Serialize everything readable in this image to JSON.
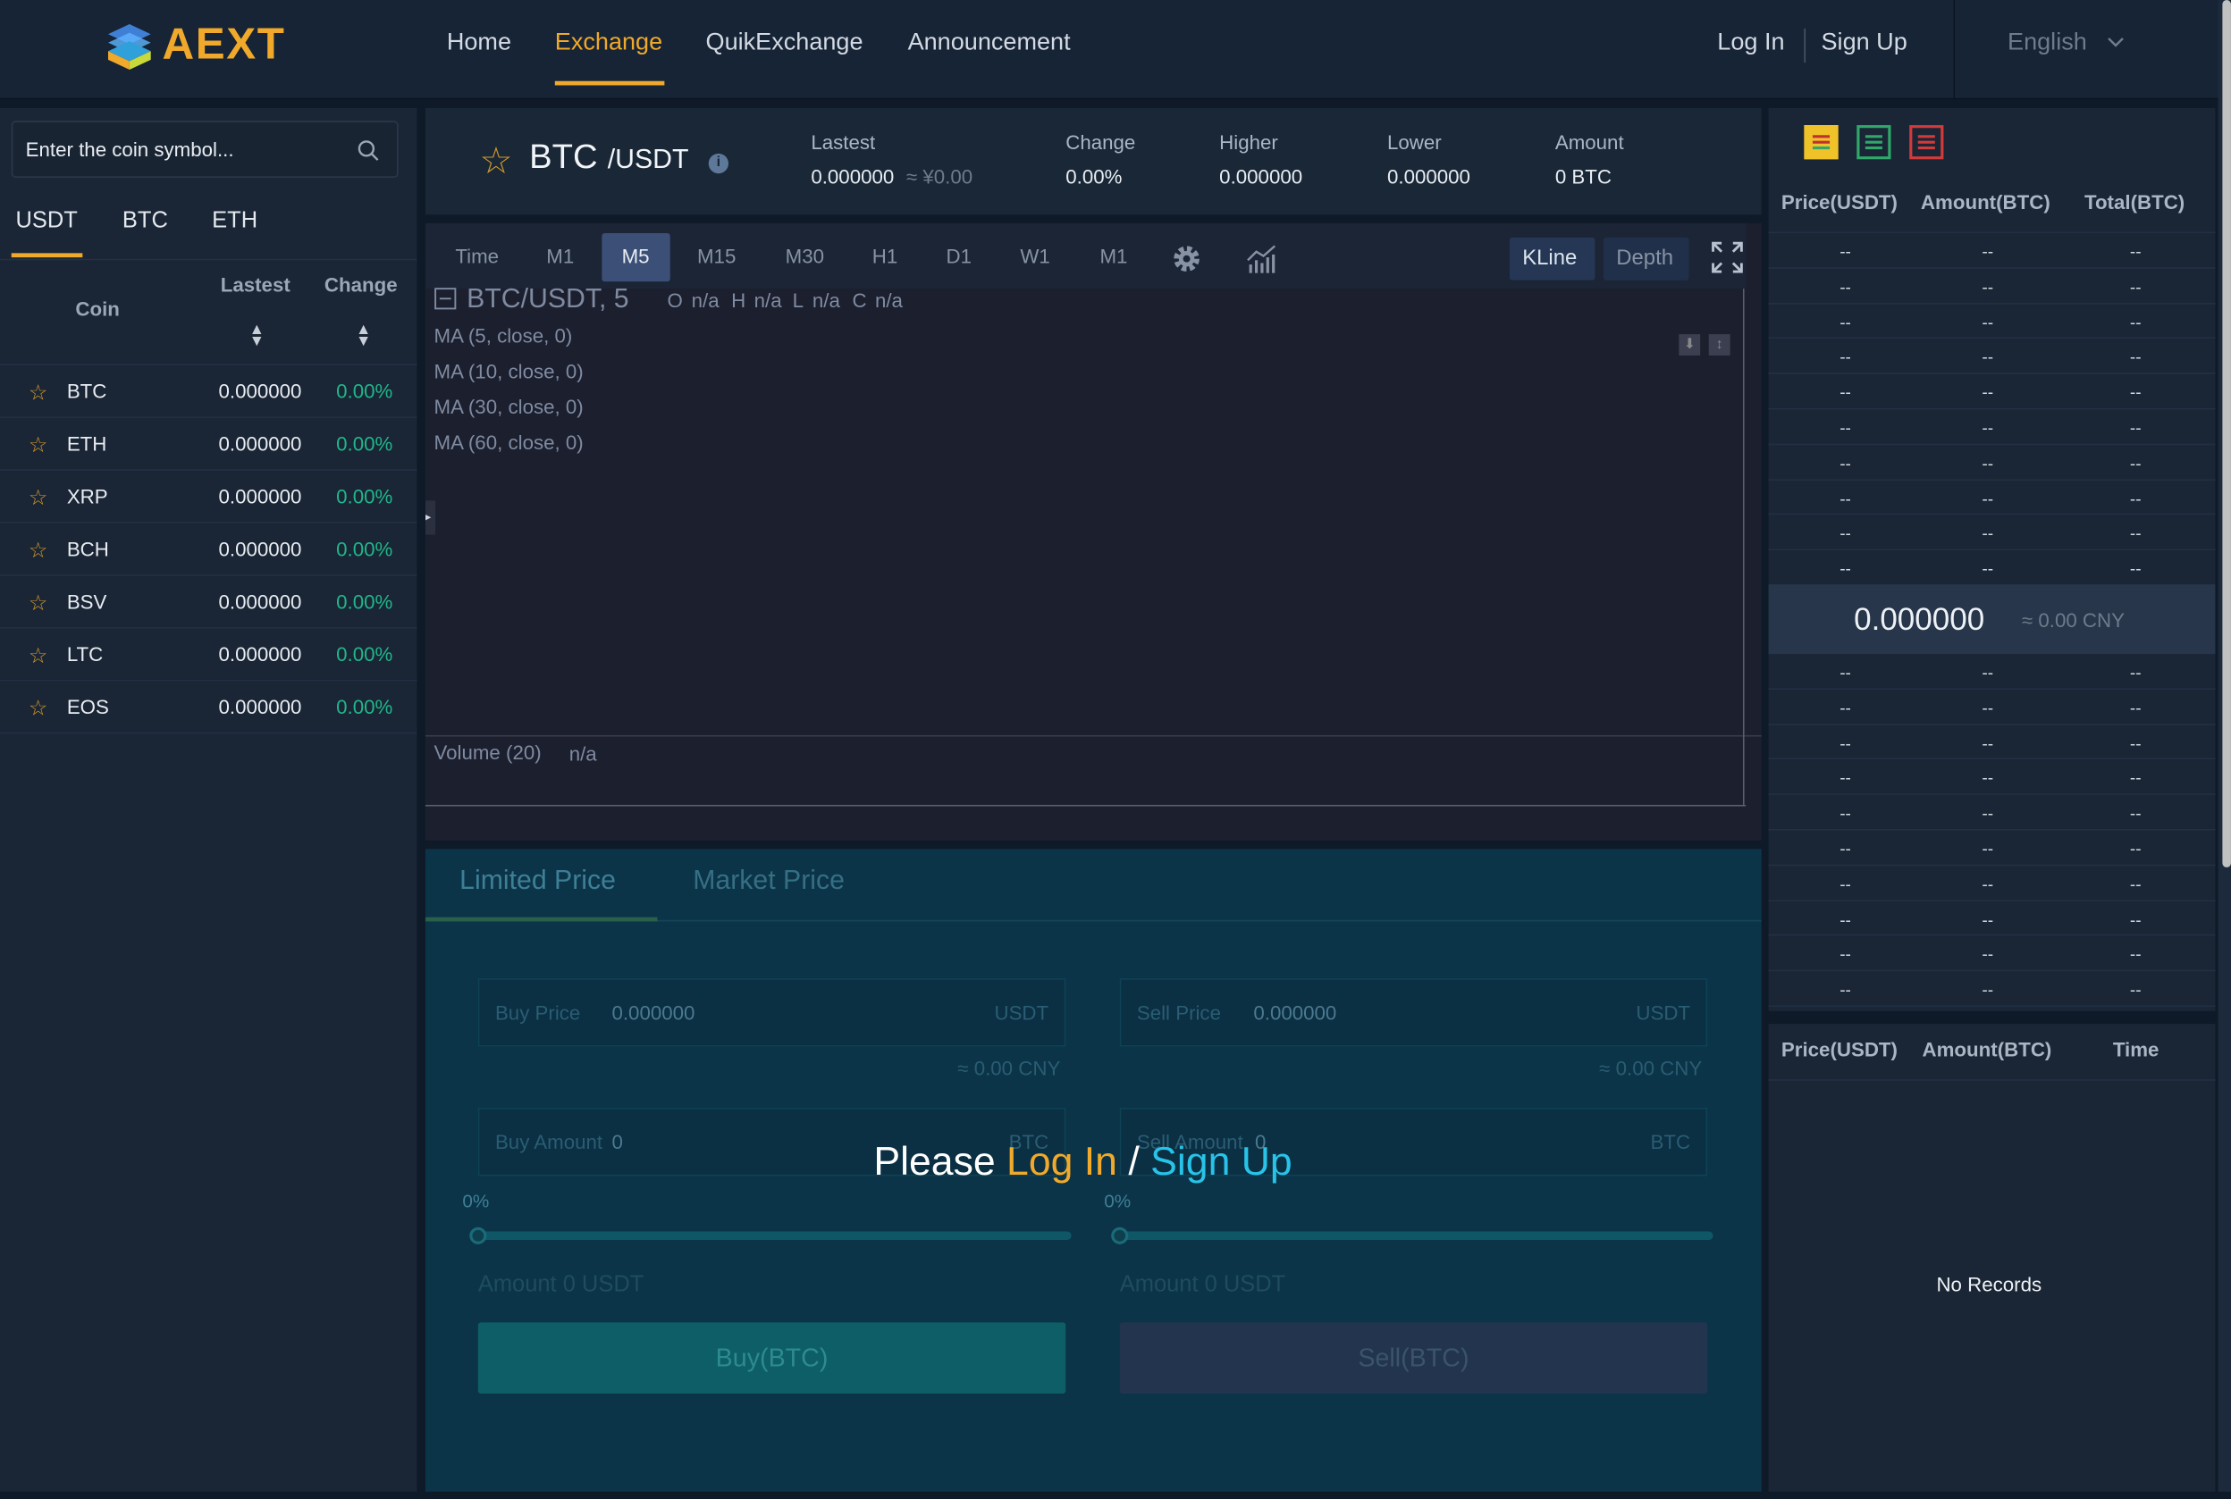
{
  "brand": {
    "name": "AEXT",
    "accent": "#f0a92a"
  },
  "nav": {
    "items": [
      "Home",
      "Exchange",
      "QuikExchange",
      "Announcement"
    ],
    "active": "Exchange",
    "login": "Log In",
    "signup": "Sign Up",
    "language": "English"
  },
  "market": {
    "search_placeholder": "Enter the coin symbol...",
    "tabs": [
      "USDT",
      "BTC",
      "ETH"
    ],
    "active_tab": "USDT",
    "columns": {
      "coin": "Coin",
      "latest": "Lastest",
      "change": "Change"
    },
    "rows": [
      {
        "symbol": "BTC",
        "price": "0.000000",
        "change": "0.00%"
      },
      {
        "symbol": "ETH",
        "price": "0.000000",
        "change": "0.00%"
      },
      {
        "symbol": "XRP",
        "price": "0.000000",
        "change": "0.00%"
      },
      {
        "symbol": "BCH",
        "price": "0.000000",
        "change": "0.00%"
      },
      {
        "symbol": "BSV",
        "price": "0.000000",
        "change": "0.00%"
      },
      {
        "symbol": "LTC",
        "price": "0.000000",
        "change": "0.00%"
      },
      {
        "symbol": "EOS",
        "price": "0.000000",
        "change": "0.00%"
      }
    ]
  },
  "ticker": {
    "base": "BTC",
    "quote": "/USDT",
    "latest_label": "Lastest",
    "latest_value": "0.000000",
    "latest_cny": "≈ ¥0.00",
    "change_label": "Change",
    "change_value": "0.00%",
    "higher_label": "Higher",
    "higher_value": "0.000000",
    "lower_label": "Lower",
    "lower_value": "0.000000",
    "amount_label": "Amount",
    "amount_value": "0 BTC"
  },
  "chart": {
    "timeframes": [
      "Time",
      "M1",
      "M5",
      "M15",
      "M30",
      "H1",
      "D1",
      "W1",
      "M1"
    ],
    "active_timeframe": "M5",
    "kline_label": "KLine",
    "depth_label": "Depth",
    "pair_title": "BTC/USDT, 5",
    "ohlc": [
      "O",
      "n/a",
      "H",
      "n/a",
      "L",
      "n/a",
      "C",
      "n/a"
    ],
    "indicators": [
      "MA (5, close, 0)",
      "MA (10, close, 0)",
      "MA (30, close, 0)",
      "MA (60, close, 0)"
    ],
    "volume_label": "Volume (20)",
    "volume_value": "n/a"
  },
  "trade": {
    "tabs": [
      "Limited Price",
      "Market Price"
    ],
    "buy": {
      "price_label": "Buy Price",
      "price_value": "0.000000",
      "price_unit": "USDT",
      "cny": "≈ 0.00 CNY",
      "amount_label": "Buy Amount",
      "amount_value": "0",
      "amount_unit": "BTC",
      "percent": "0%",
      "total": "Amount 0 USDT",
      "button": "Buy(BTC)"
    },
    "sell": {
      "price_label": "Sell Price",
      "price_value": "0.000000",
      "price_unit": "USDT",
      "cny": "≈ 0.00 CNY",
      "amount_label": "Sell Amount",
      "amount_value": "0",
      "amount_unit": "BTC",
      "percent": "0%",
      "total": "Amount 0 USDT",
      "button": "Sell(BTC)"
    },
    "prompt": {
      "please": "Please",
      "login": "Log In",
      "sep": "/",
      "signup": "Sign Up"
    }
  },
  "orderbook": {
    "headers": [
      "Price(USDT)",
      "Amount(BTC)",
      "Total(BTC)"
    ],
    "placeholder": "--",
    "mid_price": "0.000000",
    "mid_cny": "≈ 0.00 CNY"
  },
  "trades": {
    "headers": [
      "Price(USDT)",
      "Amount(BTC)",
      "Time"
    ],
    "empty": "No Records"
  }
}
